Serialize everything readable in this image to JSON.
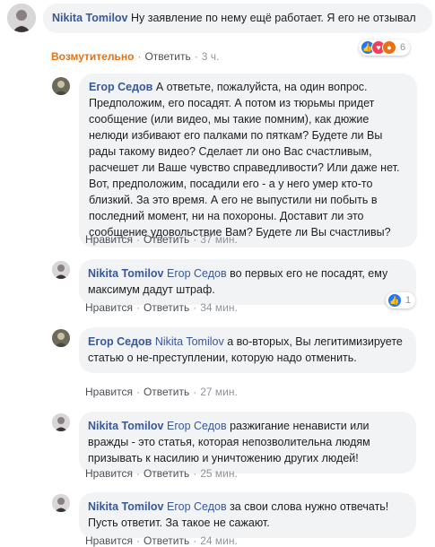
{
  "comments": [
    {
      "author": "Nikita Tomilov",
      "tag": "",
      "text": "Ну заявление по нему ещё работает. Я его не отзывал",
      "actions": [
        "Возмутительно",
        "Ответить",
        "3 ч."
      ],
      "reaction_count": "6"
    },
    {
      "author": "Егор Седов",
      "tag": "",
      "text": "А ответьте, пожалуйста, на один вопрос. Предположим, его посадят. А потом из тюрьмы придет сообщение (или видео, мы такие помним), как дюжие нелюди избивают его палками по пяткам? Будете ли Вы рады такому видео? Сделает ли оно Вас счастливым, расчешет ли Ваше чувство справедливости? Или даже нет. Вот, предположим, посадили его - а у него умер кто-то близкий. За это время. А его не выпустили ни побыть в последний момент, ни на похороны. Доставит ли это сообщение удовольствие Вам? Будете ли Вы счастливы?",
      "actions": [
        "Нравится",
        "Ответить",
        "37 мин."
      ]
    },
    {
      "author": "Nikita Tomilov",
      "tag": "Егор Седов",
      "text": "во первых его не посадят, ему максимум дадут штраф.",
      "actions": [
        "Нравится",
        "Ответить",
        "34 мин."
      ],
      "reaction_count": "1"
    },
    {
      "author": "Егор Седов",
      "tag": "Nikita Tomilov",
      "text": "а во-вторых, Вы легитимизируете статью о не-преступлении, которую надо отменить.",
      "actions": [
        "Нравится",
        "Ответить",
        "27 мин."
      ]
    },
    {
      "author": "Nikita Tomilov",
      "tag": "Егор Седов",
      "text": "разжигание ненависти или вражды - это статья, которая непозволительна людям призывать к насилию и уничтожению других людей!",
      "actions": [
        "Нравится",
        "Ответить",
        "25 мин."
      ]
    },
    {
      "author": "Nikita Tomilov",
      "tag": "Егор Седов",
      "text": "за свои слова нужно отвечать! Пусть ответит. За такое не сажают.",
      "actions": [
        "Нравится",
        "Ответить",
        "24 мин."
      ]
    }
  ],
  "colors": {
    "author": "#385898",
    "bubble": "#f2f3f5",
    "angry_action": "#e9710f",
    "like": "#2078f4",
    "love": "#f33e58",
    "angry": "#e9710f"
  },
  "icons": [
    "like-icon",
    "love-icon",
    "angry-icon"
  ]
}
